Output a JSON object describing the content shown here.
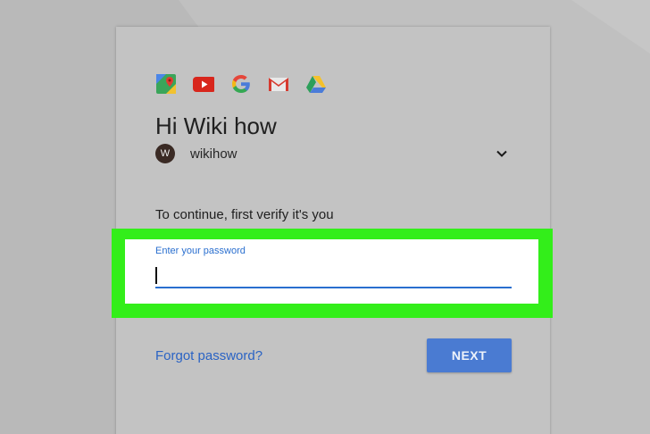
{
  "colors": {
    "background": "#b9b9b9",
    "card": "#c3c3c3",
    "highlight": "#33ee1a",
    "accent_blue": "#2a6fcf",
    "button_blue": "#4a7bd2"
  },
  "app_icons": [
    "maps-icon",
    "youtube-icon",
    "google-g-icon",
    "gmail-icon",
    "drive-icon"
  ],
  "greeting": "Hi Wiki how",
  "account": {
    "avatar_letter": "W",
    "name": "wikihow"
  },
  "verify_text": "To continue, first verify it's you",
  "password": {
    "label": "Enter your password",
    "value": ""
  },
  "forgot_link": "Forgot password?",
  "next_button": "NEXT"
}
